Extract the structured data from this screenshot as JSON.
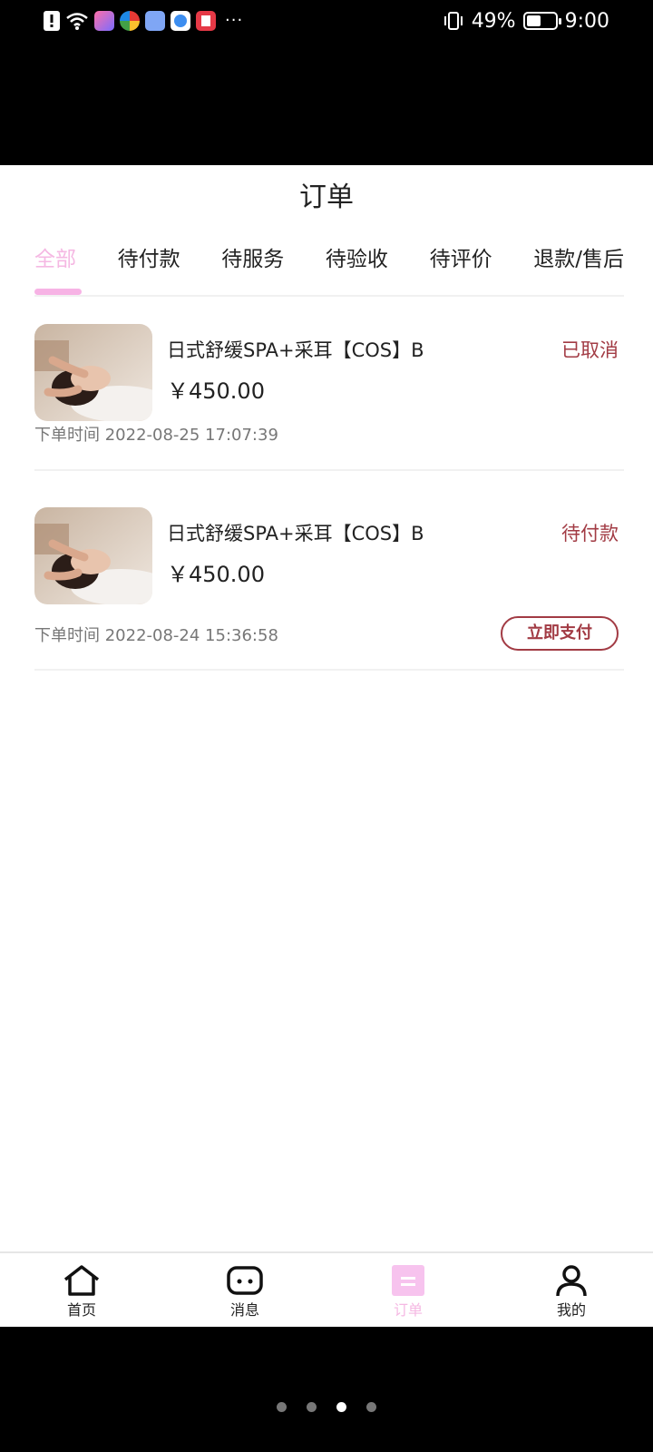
{
  "status_bar": {
    "battery_text": "49%",
    "battery_level": 0.49,
    "time": "9:00",
    "more": "···",
    "icons": [
      "alert-icon",
      "wifi-icon",
      "app-icon-1",
      "app-icon-2",
      "app-icon-3",
      "app-icon-4",
      "app-icon-5",
      "vibrate-icon",
      "battery-icon"
    ]
  },
  "page": {
    "title": "订单"
  },
  "tabs": [
    {
      "label": "全部",
      "active": true
    },
    {
      "label": "待付款",
      "active": false
    },
    {
      "label": "待服务",
      "active": false
    },
    {
      "label": "待验收",
      "active": false
    },
    {
      "label": "待评价",
      "active": false
    },
    {
      "label": "退款/售后",
      "active": false
    }
  ],
  "orders": [
    {
      "name": "日式舒缓SPA+采耳【COS】B",
      "status": "已取消",
      "price": "￥450.00",
      "time": "下单时间 2022-08-25 17:07:39"
    },
    {
      "name": "日式舒缓SPA+采耳【COS】B",
      "status": "待付款",
      "price": "￥450.00",
      "time": "下单时间 2022-08-24 15:36:58",
      "action": "立即支付"
    }
  ],
  "bottom_nav": [
    {
      "label": "首页",
      "icon": "home-icon"
    },
    {
      "label": "消息",
      "icon": "message-icon"
    },
    {
      "label": "订单",
      "icon": "orders-icon",
      "active": true
    },
    {
      "label": "我的",
      "icon": "profile-icon"
    }
  ],
  "colors": {
    "accent_pink": "#f7b3e5",
    "status_red": "#a23b44"
  }
}
